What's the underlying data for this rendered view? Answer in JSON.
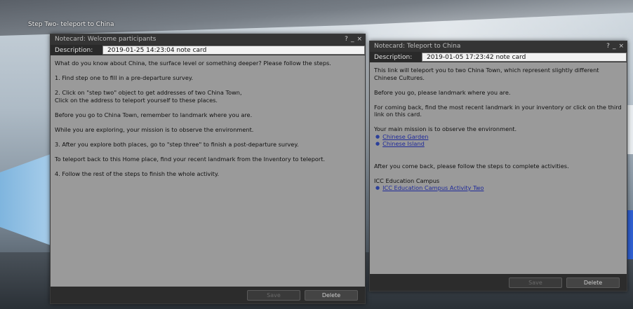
{
  "world": {
    "step_label": "Step Two- teleport to China"
  },
  "left_card": {
    "title": "Notecard: Welcome participants",
    "controls": [
      "?",
      "_",
      "×"
    ],
    "description_label": "Description:",
    "description_value": "2019-01-25 14:23:04 note card",
    "paragraphs": [
      "What do you know about China, the surface level or something deeper? Please follow the steps.",
      "1. Find step one to fill in a pre-departure survey.",
      "2. Click on \"step two\" object to get addresses of two China Town,\nClick on the address to teleport yourself to these places.",
      "Before you go to China Town, remember to landmark where you are.",
      "While you are exploring, your mission is to observe the environment.",
      "3. After you explore both places, go to \"step three\" to finish a post-departure survey.",
      "To teleport back to this Home place, find your recent landmark from the Inventory to teleport.",
      "4. Follow the rest of the steps to finish the whole activity."
    ],
    "save_label": "Save",
    "delete_label": "Delete"
  },
  "right_card": {
    "title": "Notecard: Teleport to China",
    "controls": [
      "?",
      "_",
      "×"
    ],
    "description_label": "Description:",
    "description_value": "2019-01-05 17:23:42 note card",
    "intro": "This link will teleport you to two China Town, which represent slightly different Chinese Cultures.",
    "landmark_note": "Before you go, please landmark where you are.",
    "return_note": "For coming back, find the most recent landmark in your inventory or click on the third link on this card.",
    "mission": "Your main mission is to observe the environment.",
    "links": [
      "Chinese Garden",
      "Chinese Island"
    ],
    "after_note": "After you come back, please follow the steps to complete activities.",
    "campus_label": "ICC Education Campus",
    "campus_link": "ICC Education Campus Activity Two",
    "save_label": "Save",
    "delete_label": "Delete"
  }
}
